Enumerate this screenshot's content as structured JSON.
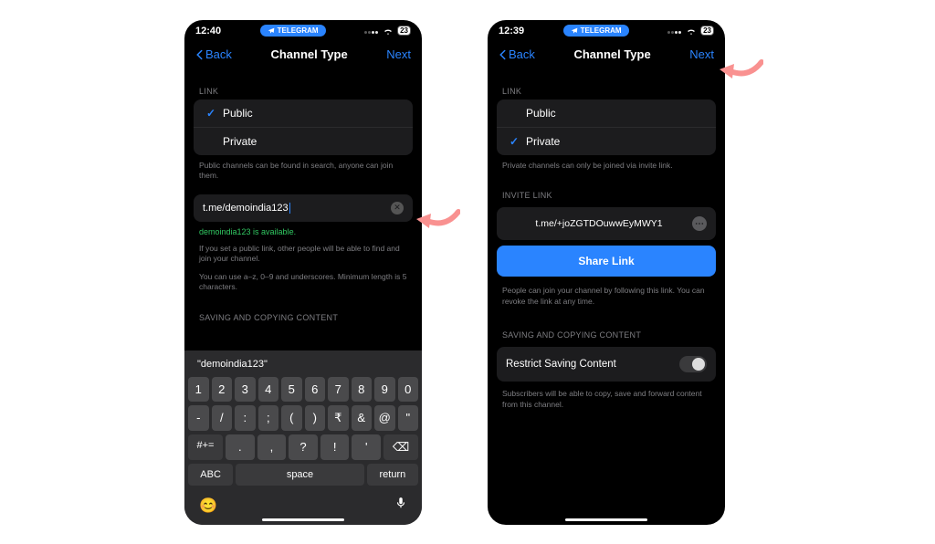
{
  "left": {
    "time": "12:40",
    "pill": "TELEGRAM",
    "battery": "23",
    "back": "Back",
    "title": "Channel Type",
    "next": "Next",
    "link_section": "LINK",
    "opts": {
      "public": "Public",
      "private": "Private"
    },
    "link_hint": "Public channels can be found in search, anyone can join them.",
    "link_value": "t.me/demoindia123",
    "avail": "demoindia123 is available.",
    "desc1": "If you set a public link, other people will be able to find and join your channel.",
    "desc2": "You can use a–z, 0–9 and underscores. Minimum length is 5 characters.",
    "saving_section": "SAVING AND COPYING CONTENT",
    "prediction": "\"demoindia123\"",
    "keys_row1": [
      "1",
      "2",
      "3",
      "4",
      "5",
      "6",
      "7",
      "8",
      "9",
      "0"
    ],
    "keys_row2": [
      "-",
      "/",
      ":",
      ";",
      "(",
      ")",
      "₹",
      "&",
      "@",
      "\""
    ],
    "keys_row3": [
      ".",
      ",",
      "?",
      "!",
      "'"
    ],
    "abc": "ABC",
    "space": "space",
    "return": "return",
    "numtoggle": "#+="
  },
  "right": {
    "time": "12:39",
    "pill": "TELEGRAM",
    "battery": "23",
    "back": "Back",
    "title": "Channel Type",
    "next": "Next",
    "link_section": "LINK",
    "opts": {
      "public": "Public",
      "private": "Private"
    },
    "link_hint": "Private channels can only be joined via invite link.",
    "invite_section": "INVITE LINK",
    "invite_url": "t.me/+joZGTDOuwwEyMWY1",
    "share": "Share Link",
    "invite_hint": "People can join your channel by following this link. You can revoke the link at any time.",
    "saving_section": "SAVING AND COPYING CONTENT",
    "restrict": "Restrict Saving Content",
    "restrict_hint": "Subscribers will be able to copy, save and forward content from this channel."
  }
}
